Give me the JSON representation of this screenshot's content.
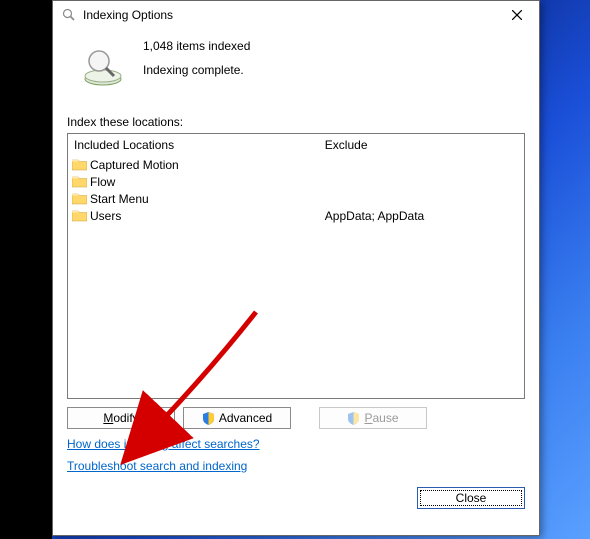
{
  "window": {
    "title": "Indexing Options"
  },
  "status": {
    "count_text": "1,048 items indexed",
    "state_text": "Indexing complete."
  },
  "section_label": "Index these locations:",
  "columns": {
    "included": "Included Locations",
    "exclude": "Exclude"
  },
  "locations": [
    {
      "name": "Captured Motion",
      "exclude": ""
    },
    {
      "name": "Flow",
      "exclude": ""
    },
    {
      "name": "Start Menu",
      "exclude": ""
    },
    {
      "name": "Users",
      "exclude": "AppData; AppData"
    }
  ],
  "buttons": {
    "modify": "Modify",
    "advanced": "Advanced",
    "pause": "Pause",
    "close": "Close"
  },
  "links": {
    "how": "How does indexing affect searches?",
    "troubleshoot": "Troubleshoot search and indexing"
  }
}
